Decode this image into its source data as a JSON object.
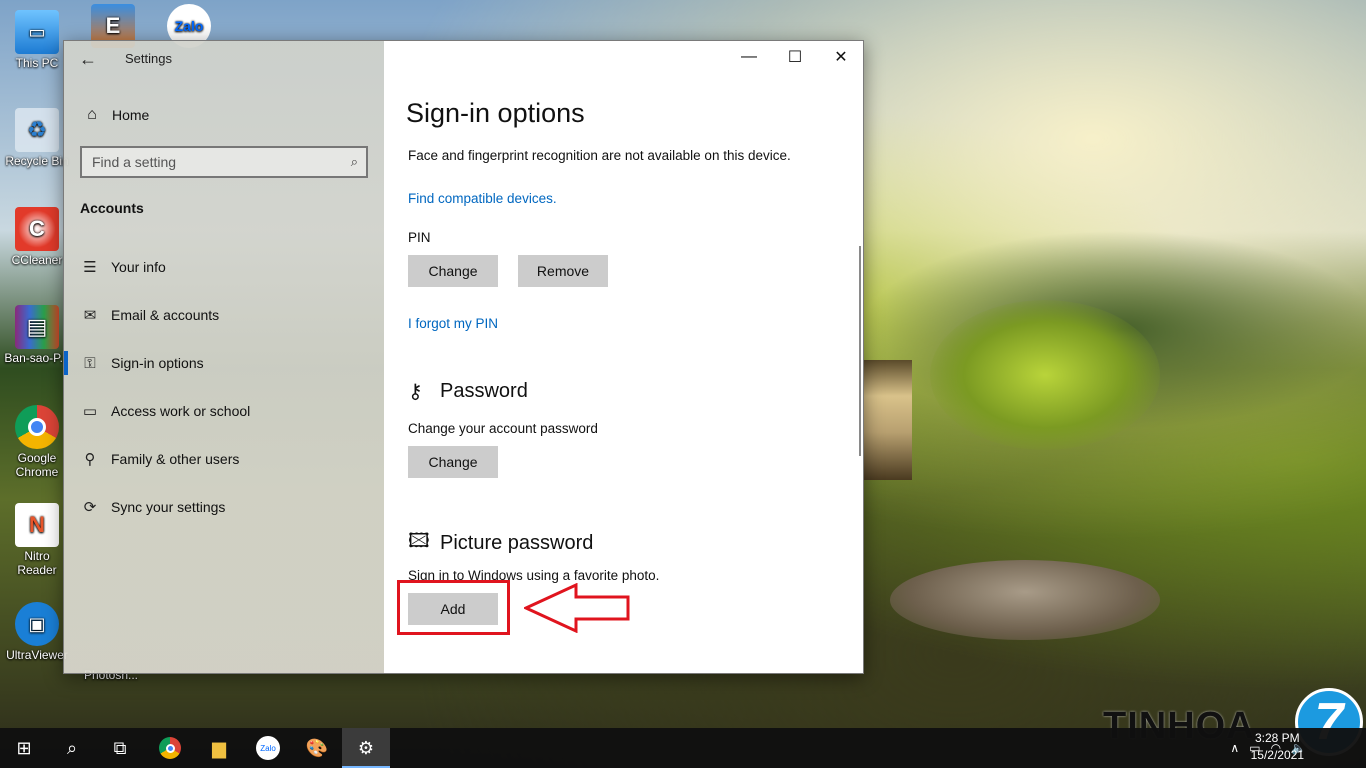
{
  "desktop": {
    "icons": [
      {
        "label": "This PC"
      },
      {
        "label": "Recycle Bin"
      },
      {
        "label": "CCleaner"
      },
      {
        "label": "Ban-sao-P..."
      },
      {
        "label": "Google Chrome"
      },
      {
        "label": "Nitro Reader"
      },
      {
        "label": "UltraViewer"
      },
      {
        "label": "Photosh..."
      }
    ],
    "top_icons": [
      {
        "label": "Zalo"
      }
    ]
  },
  "window": {
    "title": "Settings",
    "controls": {
      "minimize": "—",
      "maximize": "☐",
      "close": "✕"
    }
  },
  "sidebar": {
    "home_label": "Home",
    "search_placeholder": "Find a setting",
    "section_title": "Accounts",
    "items": [
      {
        "label": "Your info",
        "icon": "person-card-icon"
      },
      {
        "label": "Email & accounts",
        "icon": "mail-icon"
      },
      {
        "label": "Sign-in options",
        "icon": "key-icon",
        "active": true
      },
      {
        "label": "Access work or school",
        "icon": "briefcase-icon"
      },
      {
        "label": "Family & other users",
        "icon": "person-add-icon"
      },
      {
        "label": "Sync your settings",
        "icon": "sync-icon"
      }
    ]
  },
  "content": {
    "page_title": "Sign-in options",
    "face_note": "Face and fingerprint recognition are not available on this device.",
    "find_devices_link": "Find compatible devices.",
    "pin": {
      "label": "PIN",
      "change_label": "Change",
      "remove_label": "Remove",
      "forgot_link": "I forgot my PIN"
    },
    "password": {
      "heading": "Password",
      "description": "Change your account password",
      "change_label": "Change"
    },
    "picture_password": {
      "heading": "Picture password",
      "description": "Sign in to Windows using a favorite photo.",
      "add_label": "Add"
    }
  },
  "annotation": {
    "highlight_color": "#e0141e"
  },
  "taskbar": {
    "clock_time": "3:28 PM",
    "clock_date": "15/2/2021"
  },
  "watermark": {
    "brand": "TINHOA",
    "badge": "7"
  }
}
